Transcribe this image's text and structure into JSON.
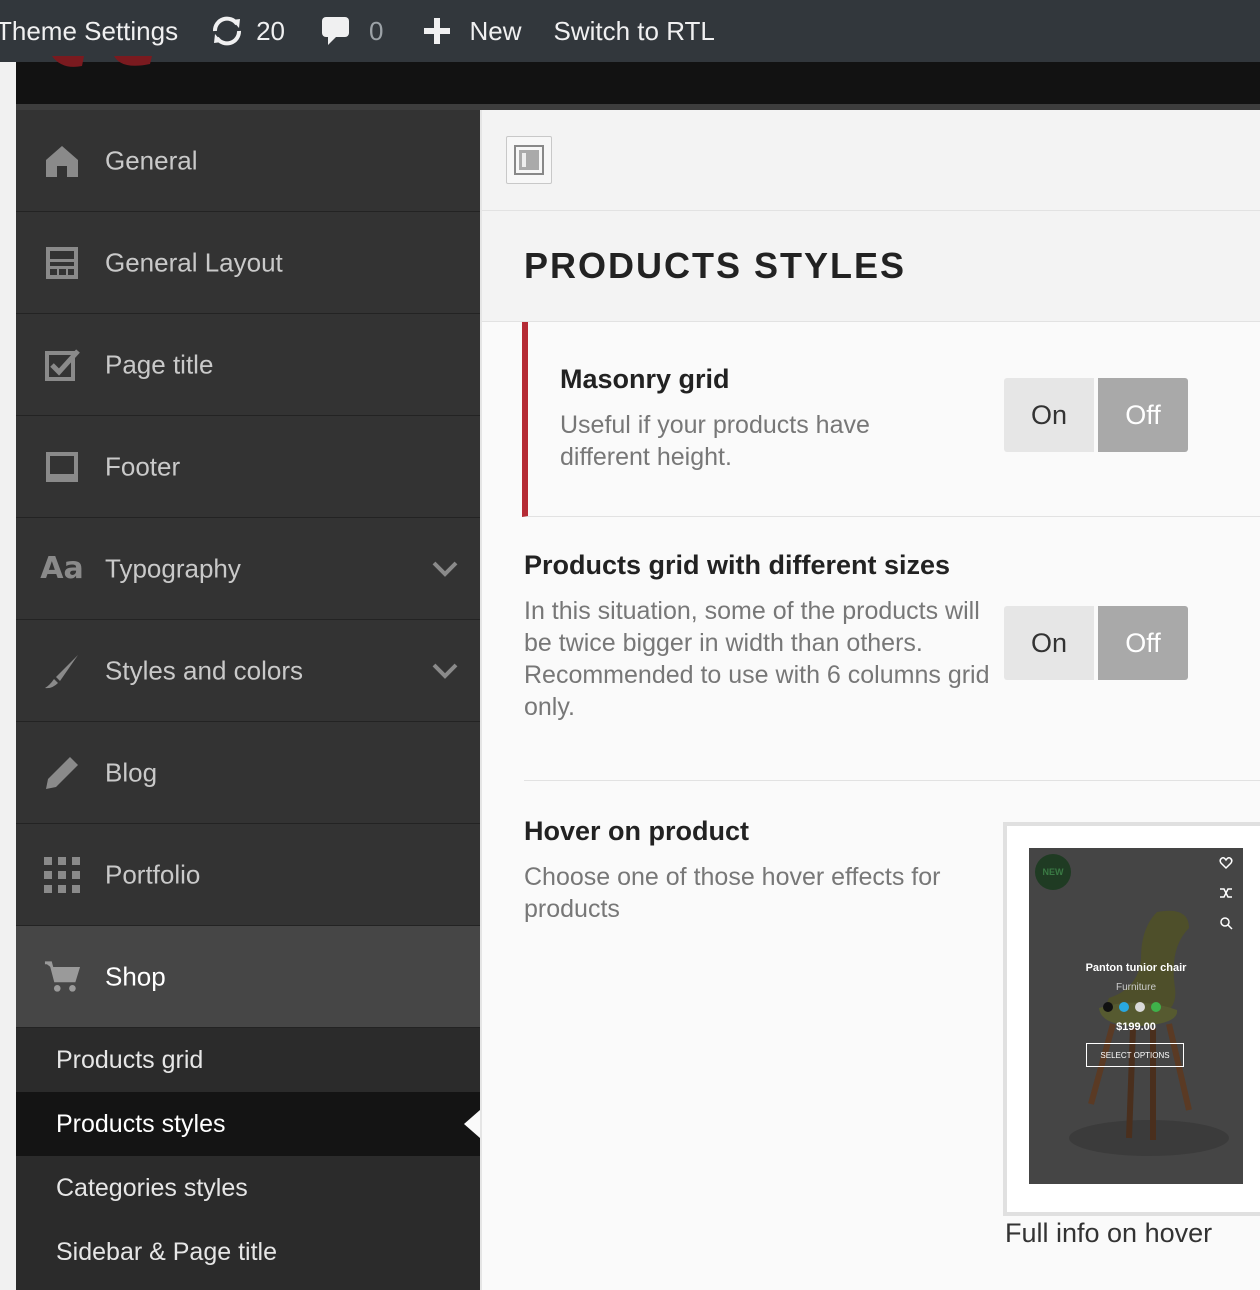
{
  "adminbar": {
    "title": "Theme Settings",
    "updates_count": "20",
    "comments_count": "0",
    "new_label": "New",
    "rtl_label": "Switch to RTL",
    "icons": [
      "refresh-icon",
      "comment-icon",
      "plus-icon"
    ]
  },
  "sidebar": {
    "items": [
      {
        "label": "General",
        "icon": "home-icon"
      },
      {
        "label": "General Layout",
        "icon": "layout-icon"
      },
      {
        "label": "Page title",
        "icon": "checkbox-icon"
      },
      {
        "label": "Footer",
        "icon": "footer-icon"
      },
      {
        "label": "Typography",
        "icon": "font-icon",
        "expandable": true
      },
      {
        "label": "Styles and colors",
        "icon": "brush-icon",
        "expandable": true
      },
      {
        "label": "Blog",
        "icon": "pencil-icon"
      },
      {
        "label": "Portfolio",
        "icon": "grid-icon"
      },
      {
        "label": "Shop",
        "icon": "cart-icon",
        "active": true
      }
    ],
    "subitems": [
      {
        "label": "Products grid"
      },
      {
        "label": "Products styles",
        "current": true
      },
      {
        "label": "Categories styles"
      },
      {
        "label": "Sidebar & Page title"
      }
    ]
  },
  "main": {
    "heading": "PRODUCTS STYLES",
    "settings": {
      "masonry": {
        "title": "Masonry grid",
        "desc": "Useful if your products have different height.",
        "on_label": "On",
        "off_label": "Off",
        "value": "Off"
      },
      "sizes": {
        "title": "Products grid with different sizes",
        "desc": "In this situation, some of the products will be twice bigger in width than others. Recommended to use with 6 columns grid only.",
        "on_label": "On",
        "off_label": "Off",
        "value": "Off"
      },
      "hover": {
        "title": "Hover on product",
        "desc": "Choose one of those hover effects for products",
        "preview": {
          "badge": "NEW",
          "product_name": "Panton tunior chair",
          "category": "Furniture",
          "price": "$199.00",
          "button": "SELECT OPTIONS",
          "swatches": [
            "#111111",
            "#29a8e0",
            "#d9d9d9",
            "#3fb24a"
          ],
          "caption": "Full info on hover"
        }
      }
    }
  },
  "colors": {
    "accent": "#b52b35",
    "adminbar": "#32373c",
    "sidebar": "#333333"
  }
}
